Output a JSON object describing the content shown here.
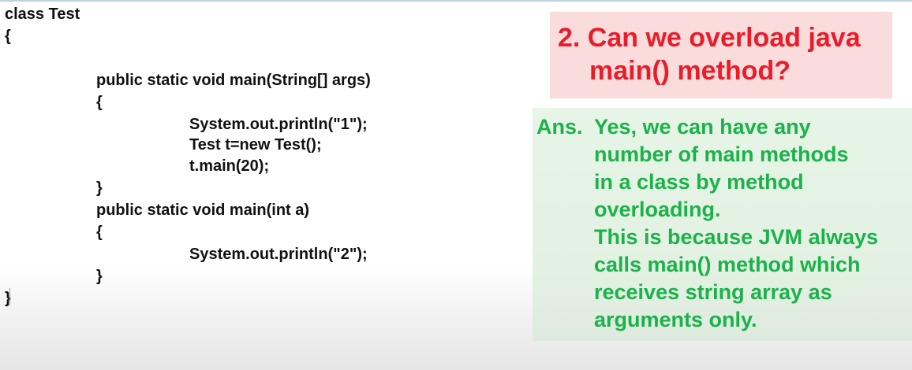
{
  "code": {
    "lines": [
      "class Test",
      "{",
      "public static void main(String[] args)",
      "{",
      "System.out.println(\"1\");",
      "Test t=new Test();",
      "t.main(20);",
      "}",
      "public static void main(int a)",
      "{",
      "System.out.println(\"2\");",
      "}",
      "}"
    ]
  },
  "question": {
    "line1": "2. Can we overload java",
    "line2": "main() method?"
  },
  "answer": {
    "prefix": "Ans.",
    "lines": [
      "Yes, we can have any",
      "number of main methods",
      "in a class by method",
      "overloading.",
      "This is because JVM always",
      "calls main() method which",
      "receives string array as",
      "arguments only."
    ]
  },
  "colors": {
    "question_text": "#ea1c2a",
    "question_bg": "#fadcdc",
    "answer_text": "#1bb24a",
    "answer_bg": "#e6f5e6",
    "code_text": "#111111"
  }
}
